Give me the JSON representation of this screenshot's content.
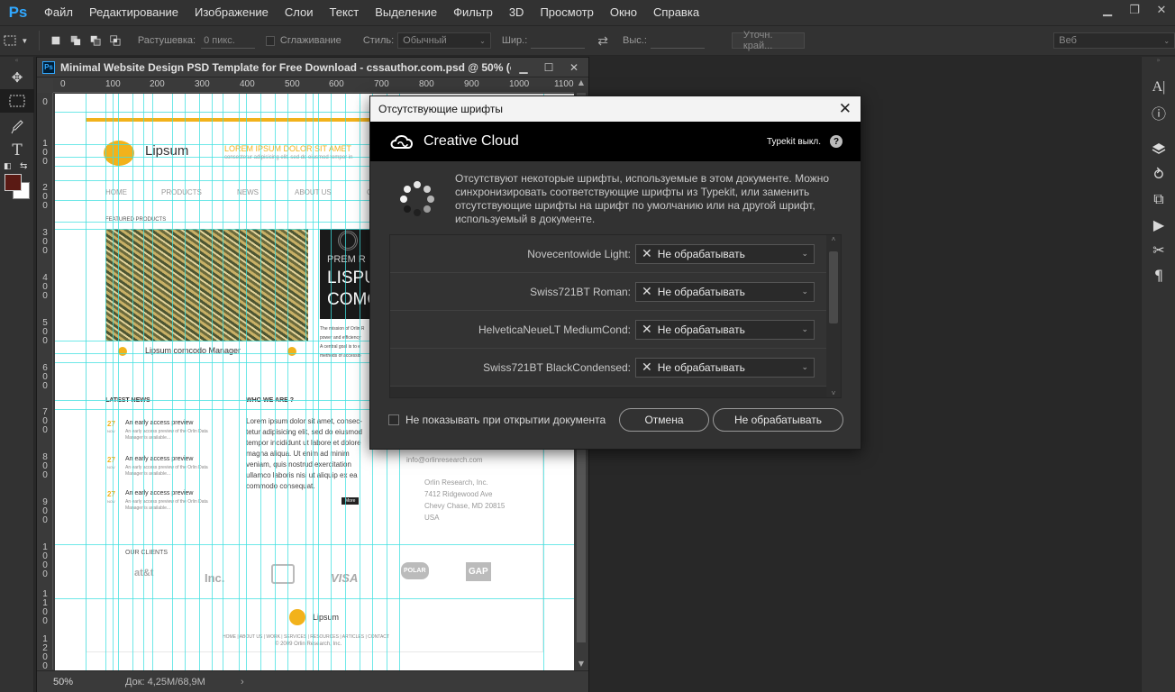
{
  "app": {
    "logo": "Ps",
    "menu": [
      "Файл",
      "Редактирование",
      "Изображение",
      "Слои",
      "Текст",
      "Выделение",
      "Фильтр",
      "3D",
      "Просмотр",
      "Окно",
      "Справка"
    ],
    "window_controls": [
      "▁",
      "❐",
      "✕"
    ]
  },
  "options": {
    "feather_label": "Растушевка:",
    "feather_value": "0 пикс.",
    "antialias_label": "Сглаживание",
    "style_label": "Стиль:",
    "style_value": "Обычный",
    "width_label": "Шир.:",
    "height_label": "Выс.:",
    "refine_button": "Уточн. край...",
    "workspace_value": "Веб"
  },
  "document": {
    "ps_icon": "Ps",
    "title": "Minimal Website Design PSD Template for Free Download - cssauthor.com.psd @ 50% (c...",
    "ruler_top": [
      "0",
      "100",
      "200",
      "300",
      "400",
      "500",
      "600",
      "700",
      "800",
      "900",
      "1000",
      "1100"
    ],
    "ruler_left": [
      [
        "0"
      ],
      [
        "1",
        "0",
        "0"
      ],
      [
        "2",
        "0",
        "0"
      ],
      [
        "3",
        "0",
        "0"
      ],
      [
        "4",
        "0",
        "0"
      ],
      [
        "5",
        "0",
        "0"
      ],
      [
        "6",
        "0",
        "0"
      ],
      [
        "7",
        "0",
        "0"
      ],
      [
        "8",
        "0",
        "0"
      ],
      [
        "9",
        "0",
        "0"
      ],
      [
        "1",
        "0",
        "0",
        "0"
      ],
      [
        "1",
        "1",
        "0",
        "0"
      ],
      [
        "1",
        "2",
        "0",
        "0"
      ]
    ],
    "zoom": "50%",
    "doc_size": "Док: 4,25M/68,9M"
  },
  "canvas": {
    "logo_text": "Lipsum",
    "tagline": "LOREM IPSUM DOLOR SIT AMET",
    "tagline_sub": "consectetur adipisicing elit, sed do eiusmod tempor in",
    "nav": [
      "HOME",
      "PRODUCTS",
      "NEWS",
      "ABOUT US",
      "C"
    ],
    "featured_label": "FEATURED PRODUCTS",
    "photo2_text1": "PREM R",
    "photo2_text2": "LISPU",
    "photo2_text3": "COMO",
    "photo2_caption1": "The mission of Orlin R",
    "photo2_caption2": "power and efficiency",
    "photo2_caption3": "A central goal is to e",
    "photo2_caption4": "methods of accessib",
    "product_caption": "Lipsum comcodo Manager",
    "latest_news": "LATEST NEWS",
    "who_we_are": "WHO WE ARE ?",
    "news": [
      {
        "day": "27",
        "mon": "NOV",
        "title": "An early access preview",
        "l1": "An early access preview of the Orlin Data",
        "l2": "Manager is available..."
      },
      {
        "day": "27",
        "mon": "NOV",
        "title": "An early access preview",
        "l1": "An early access preview of the Orlin Data",
        "l2": "Manager is available..."
      },
      {
        "day": "27",
        "mon": "NOV",
        "title": "An early access preview",
        "l1": "An early access preview of the Orlin Data",
        "l2": "Manager is available..."
      }
    ],
    "who_text": [
      "Lorem ipsum dolor sit amet, consec-",
      "tetur adipisicing elit, sed do eiusmod",
      "tempor incididunt ut labore et dolore",
      "magna aliqua. Ut enim ad minim",
      "veniam, quis nostrud exercitation",
      "ullamco laboris nisi ut aliquip ex ea",
      "commodo consequat."
    ],
    "more_btn": "More",
    "contact_email": "info@orlinresearch.com",
    "contact_addr": [
      "Orlin Research, Inc.",
      "7412 Ridgewood Ave",
      "Chevy Chase, MD 20815",
      "USA"
    ],
    "our_clients": "OUR CLIENTS",
    "clients": [
      "at&t",
      "Inc.",
      "",
      "VISA",
      "POLAR",
      "GAP"
    ],
    "footer_logo": "Lipsum",
    "footer_nav": "HOME  |  ABOUT US  |  WORK  |  SERVICES  |  RESOURCES  |  ARTICLES  |  CONTACT",
    "footer_copy": "© 2009 Orlin Research, Inc."
  },
  "dialog": {
    "title": "Отсутствующие шрифты",
    "brand": "Creative Cloud",
    "typekit": "Typekit выкл.",
    "help": "?",
    "message": "Отсутствуют некоторые шрифты, используемые в этом документе. Можно синхронизировать соответствующие шрифты из Typekit, или заменить отсутствующие шрифты на шрифт по умолчанию или на другой шрифт, используемый в документе.",
    "fonts": [
      {
        "name": "Novecentowide Light:",
        "action": "Не обрабатывать"
      },
      {
        "name": "Swiss721BT Roman:",
        "action": "Не обрабатывать"
      },
      {
        "name": "HelveticaNeueLT MediumCond:",
        "action": "Не обрабатывать"
      },
      {
        "name": "Swiss721BT BlackCondensed:",
        "action": "Не обрабатывать"
      }
    ],
    "dont_show": "Не показывать при открытии документа",
    "cancel": "Отмена",
    "dont_process": "Не обрабатывать"
  },
  "colors": {
    "accent_gold": "#f2b21b",
    "guide_cyan": "#3fe0e0",
    "foreground_swatch": "#5a1a14",
    "background_swatch": "#ffffff"
  }
}
